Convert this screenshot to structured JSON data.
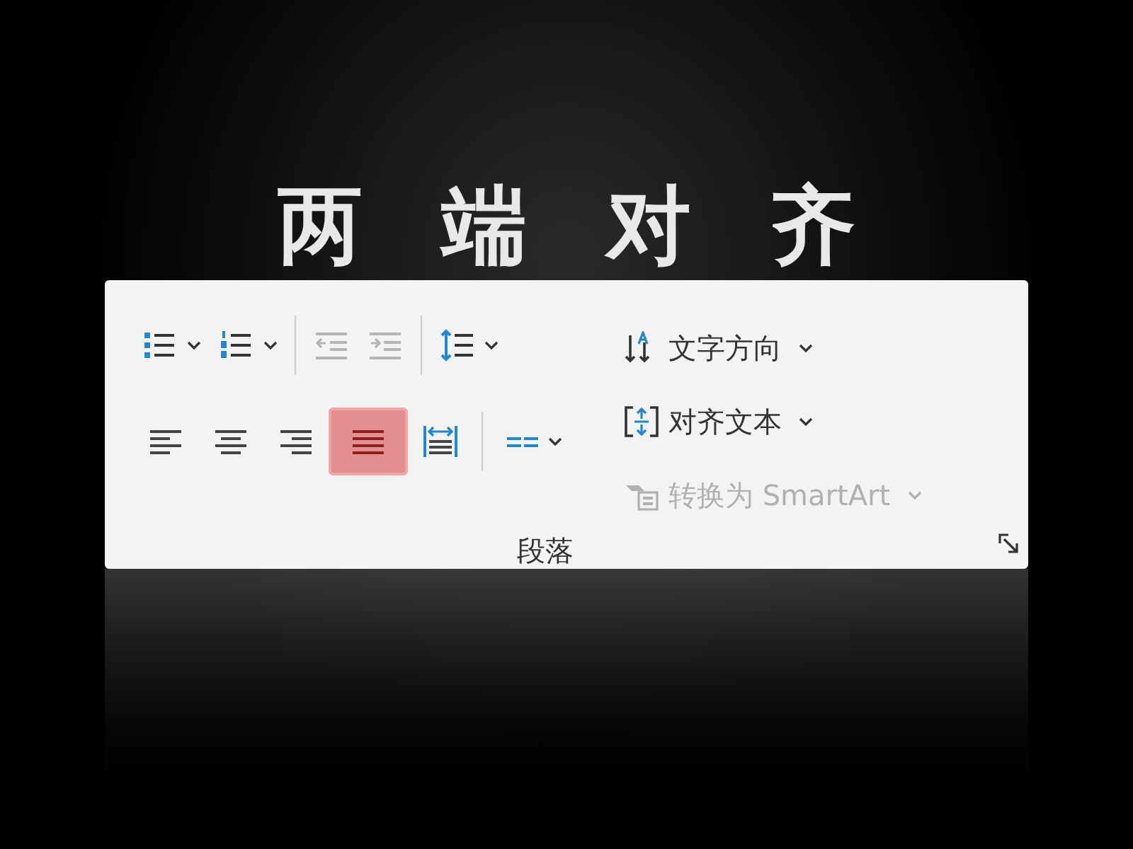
{
  "heading": "两端对齐",
  "group": {
    "label": "段落",
    "list_buttons": [
      {
        "kind": "bullets"
      },
      {
        "kind": "numbering"
      }
    ],
    "indent_buttons": [
      {
        "kind": "decrease",
        "disabled": true
      },
      {
        "kind": "increase",
        "disabled": true
      }
    ],
    "line_spacing": {
      "kind": "line_spacing"
    },
    "align_buttons": [
      {
        "kind": "left",
        "selected": false
      },
      {
        "kind": "center",
        "selected": false
      },
      {
        "kind": "right",
        "selected": false
      },
      {
        "kind": "justify",
        "selected": true
      },
      {
        "kind": "distributed",
        "selected": false
      }
    ],
    "columns": {
      "kind": "columns"
    },
    "text_commands": [
      {
        "kind": "direction",
        "label": "文字方向",
        "disabled": false
      },
      {
        "kind": "align",
        "label": "对齐文本",
        "disabled": false
      },
      {
        "kind": "smartart",
        "label": "转换为 SmartArt",
        "disabled": true
      }
    ]
  }
}
